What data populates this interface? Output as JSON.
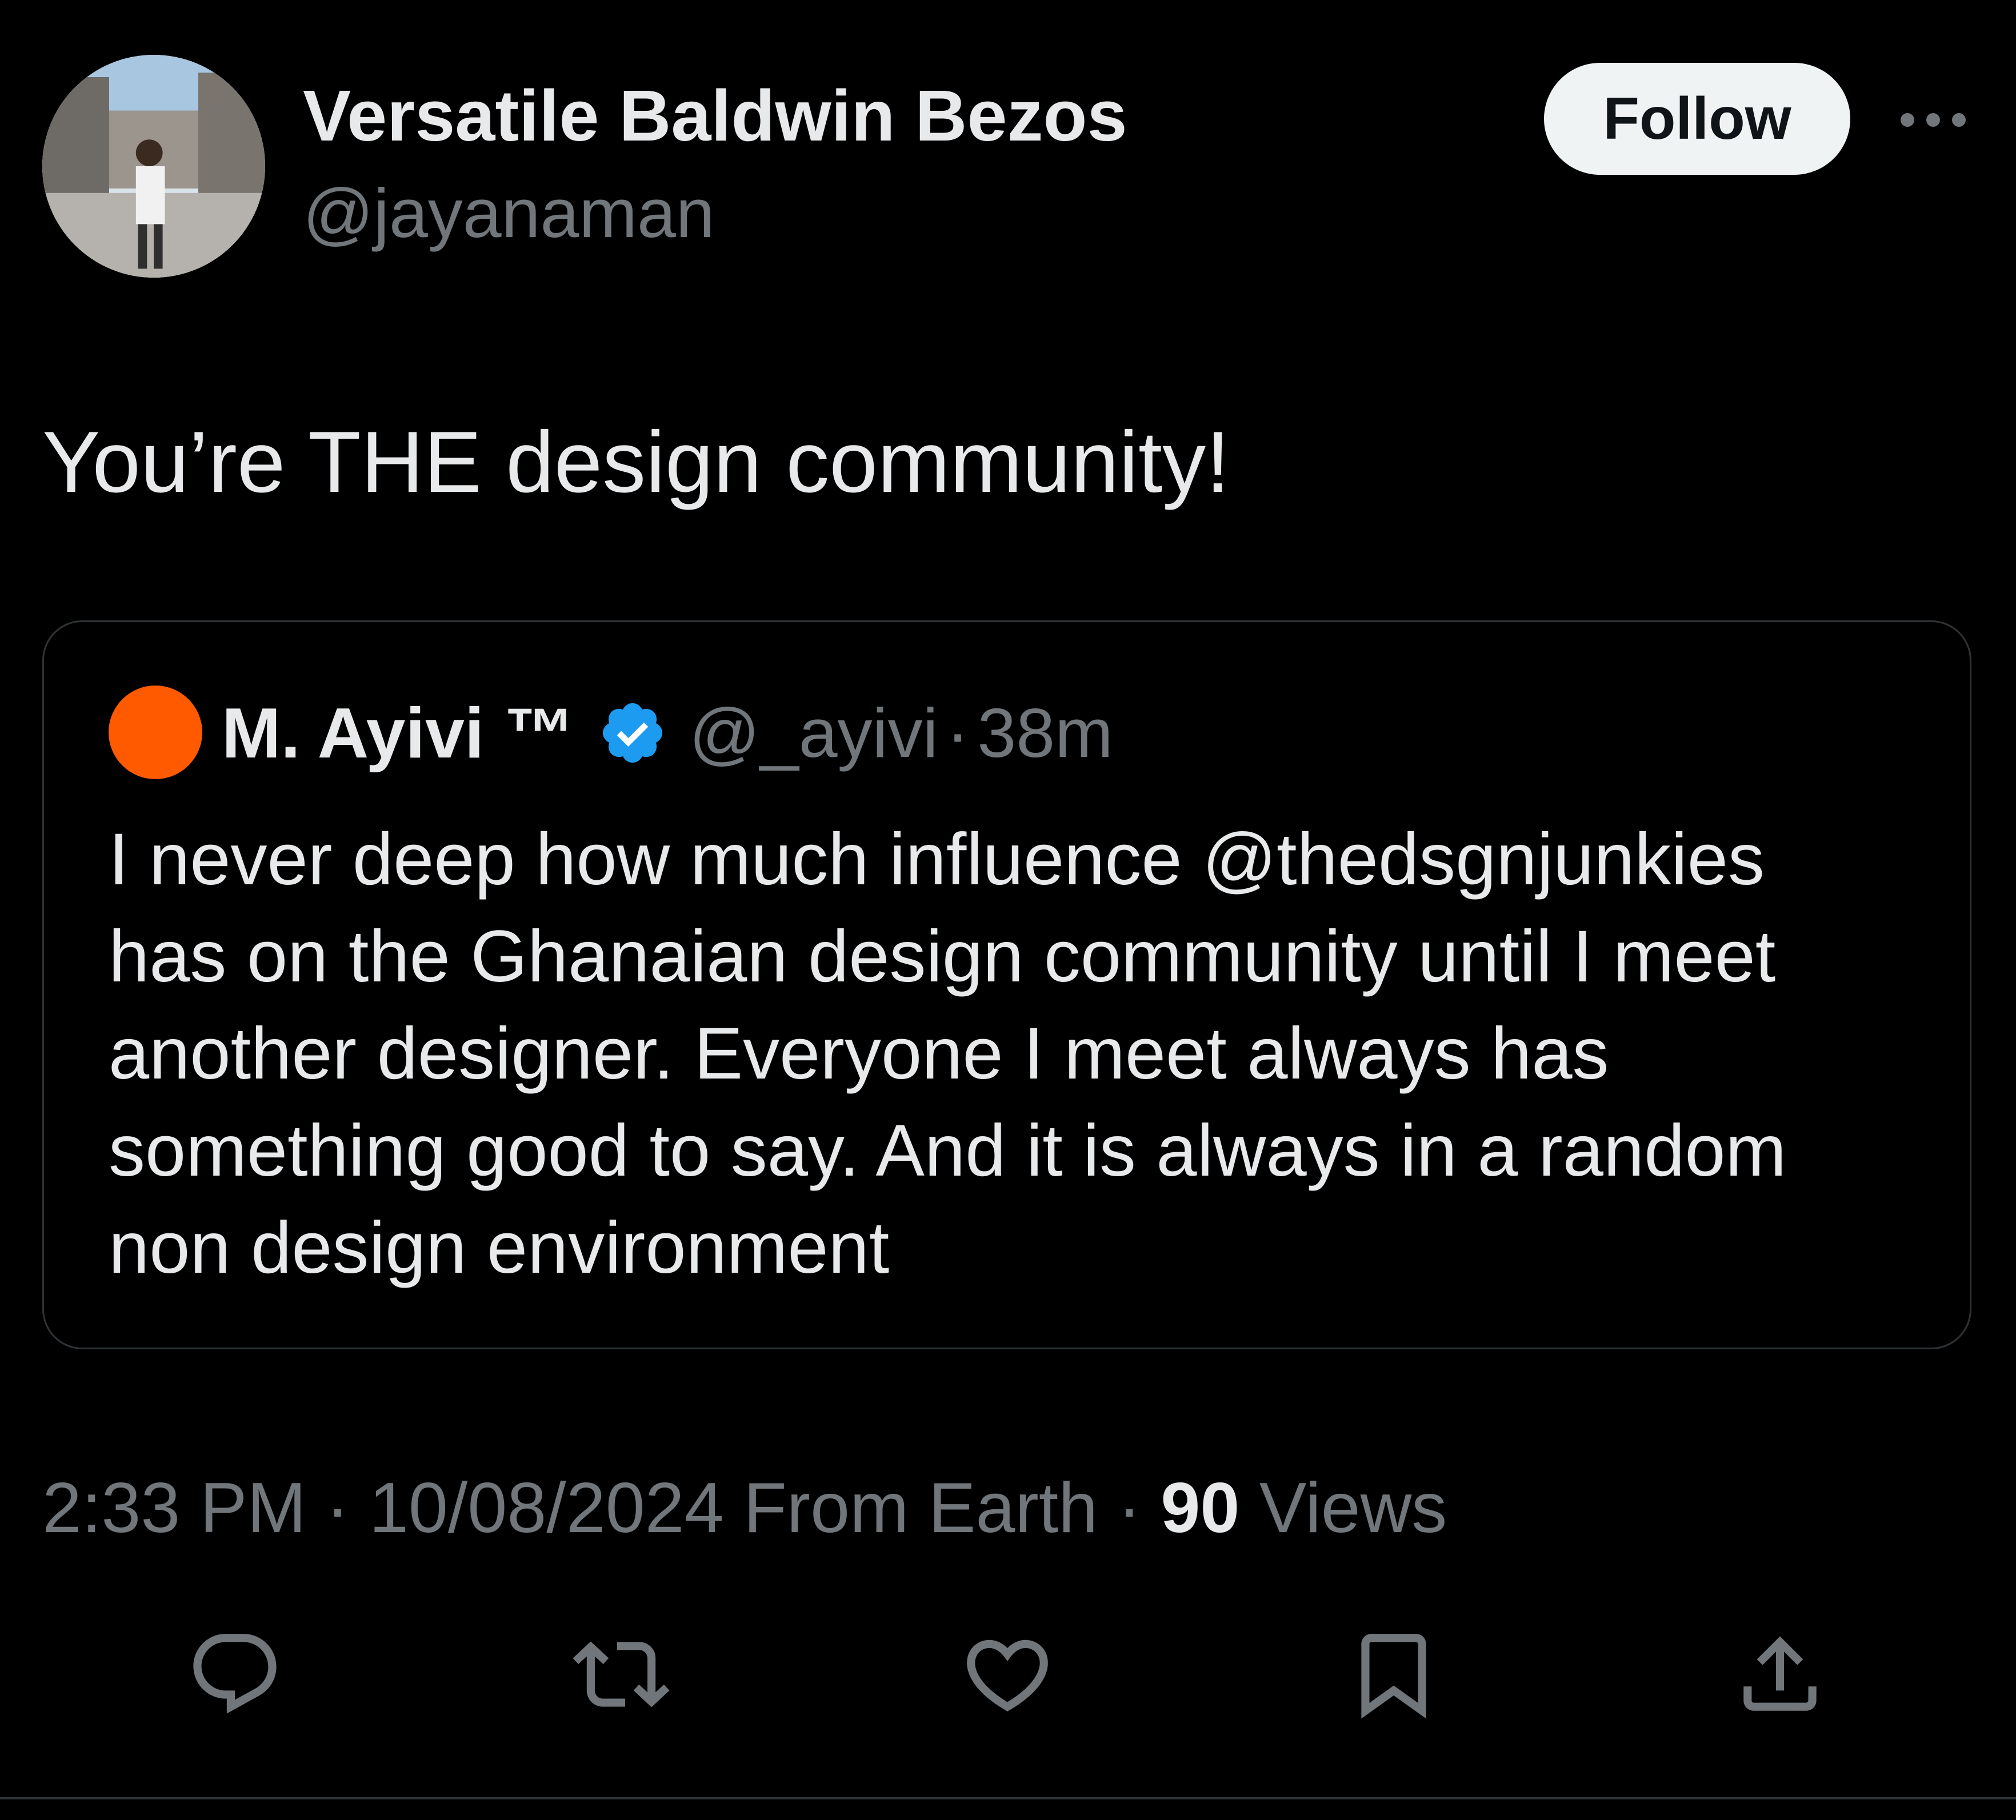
{
  "author": {
    "display_name": "Versatile Baldwin Bezos",
    "handle": "@jayanaman"
  },
  "follow_label": "Follow",
  "tweet_text": "You’re THE design community!",
  "quoted_tweet": {
    "display_name": "M. Ayivi ™",
    "handle": "@_ayivi",
    "separator": "·",
    "time": "38m",
    "avatar_color": "#ff5a00",
    "verified": true,
    "body_lines": [
      "I never deep how much influence @thedsgnjunkies",
      "has on the Ghanaian design community until I meet",
      "another designer. Everyone I meet always has",
      "something good to say. And it is always in a random",
      "non design environment"
    ]
  },
  "meta": {
    "time": "2:33 PM",
    "date": "10/08/2024",
    "source": "From Earth",
    "separator": "·",
    "views_count": "90",
    "views_label": "Views"
  },
  "actions": [
    {
      "icon": "reply-icon"
    },
    {
      "icon": "retweet-icon"
    },
    {
      "icon": "like-icon"
    },
    {
      "icon": "bookmark-icon"
    },
    {
      "icon": "share-icon"
    }
  ],
  "colors": {
    "background": "#000000",
    "primary_text": "#e7e9ea",
    "secondary_text": "#71767b",
    "border": "#2f3336",
    "verified_blue": "#1d9bf0",
    "follow_button_bg": "#eff3f4"
  }
}
